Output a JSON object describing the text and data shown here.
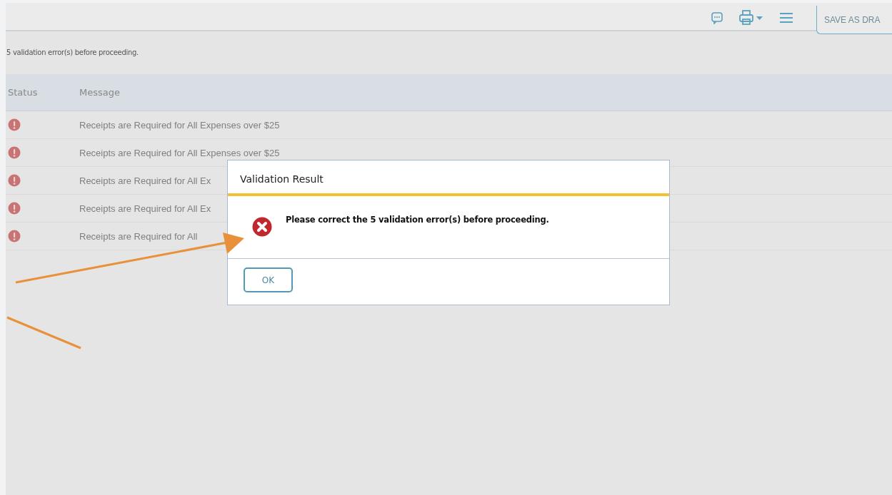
{
  "toolbar": {
    "save_button": "SAVE AS DRA"
  },
  "summary": "5 validation error(s) before proceeding.",
  "table": {
    "columns": [
      "Status",
      "Message"
    ],
    "rows": [
      {
        "message": "Receipts are Required for All Expenses over $25"
      },
      {
        "message": "Receipts are Required for All Expenses over $25"
      },
      {
        "message": "Receipts are Required for All Ex"
      },
      {
        "message": "Receipts are Required for All Ex"
      },
      {
        "message": "Receipts are Required for All"
      }
    ]
  },
  "dialog": {
    "title": "Validation Result",
    "message": "Please correct the 5 validation error(s) before proceeding.",
    "buttons": [
      "OK"
    ]
  }
}
